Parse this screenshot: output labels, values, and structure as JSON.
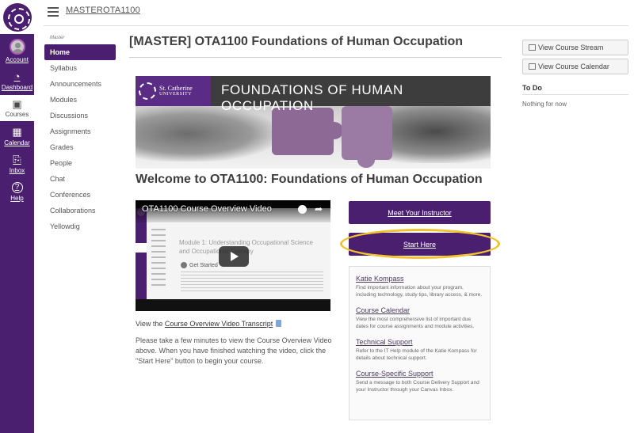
{
  "global_nav": {
    "items": [
      {
        "label": "Account",
        "icon": "avatar-icon"
      },
      {
        "label": "Dashboard",
        "icon": "dashboard-icon"
      },
      {
        "label": "Courses",
        "icon": "courses-icon"
      },
      {
        "label": "Calendar",
        "icon": "calendar-icon"
      },
      {
        "label": "Inbox",
        "icon": "inbox-icon"
      },
      {
        "label": "Help",
        "icon": "help-icon"
      }
    ],
    "icons": {
      "dashboard": "◔",
      "courses": "▣",
      "calendar": "▦",
      "inbox": "⎘",
      "help": "?"
    }
  },
  "header": {
    "breadcrumb": "MASTEROTA1100"
  },
  "course_nav": {
    "subtitle": "Master",
    "items": [
      "Home",
      "Syllabus",
      "Announcements",
      "Modules",
      "Discussions",
      "Assignments",
      "Grades",
      "People",
      "Chat",
      "Conferences",
      "Collaborations",
      "Yellowdig"
    ],
    "active": "Home"
  },
  "main": {
    "title": "[MASTER] OTA1100 Foundations of Human Occupation",
    "banner": {
      "university_line1": "St. Catherine",
      "university_line2": "UNIVERSITY",
      "title": "FOUNDATIONS OF HUMAN OCCUPATION"
    },
    "welcome": "Welcome to OTA1100: Foundations of Human Occupation",
    "video": {
      "title": "OTA1100 Course Overview Video",
      "inner_heading": "Module 1: Understanding Occupational Science and Occupational Therapy",
      "inner_subheading": "Get Started",
      "play_label": "Play"
    },
    "transcript_prefix": "View the ",
    "transcript_link": "Course Overview Video Transcript",
    "blurb": "Please take a few minutes to view the Course Overview Video above. When you have finished watching the video, click the \"Start Here\" button to begin your course.",
    "buttons": {
      "meet": "Meet Your Instructor",
      "start": "Start Here"
    },
    "resources": [
      {
        "title": "Katie Kompass",
        "desc": "Find important information about your program, including technology, study tips, library access, & more."
      },
      {
        "title": "Course Calendar",
        "desc": "View the most comprehensive list of important due dates for course assignments and module activities."
      },
      {
        "title": "Technical Support",
        "desc": "Refer to the IT Help module of the Katie Kompass for details about technical support."
      },
      {
        "title": "Course-Specific Support",
        "desc": "Send a message to both Course Delivery Support and your Instructor through your Canvas Inbox."
      }
    ]
  },
  "sidebar_right": {
    "stream_button": "View Course Stream",
    "calendar_button": "View Course Calendar",
    "todo_heading": "To Do",
    "todo_empty": "Nothing for now"
  },
  "colors": {
    "brand_purple": "#4b1f6f",
    "highlight_ring": "#f2c12e"
  }
}
